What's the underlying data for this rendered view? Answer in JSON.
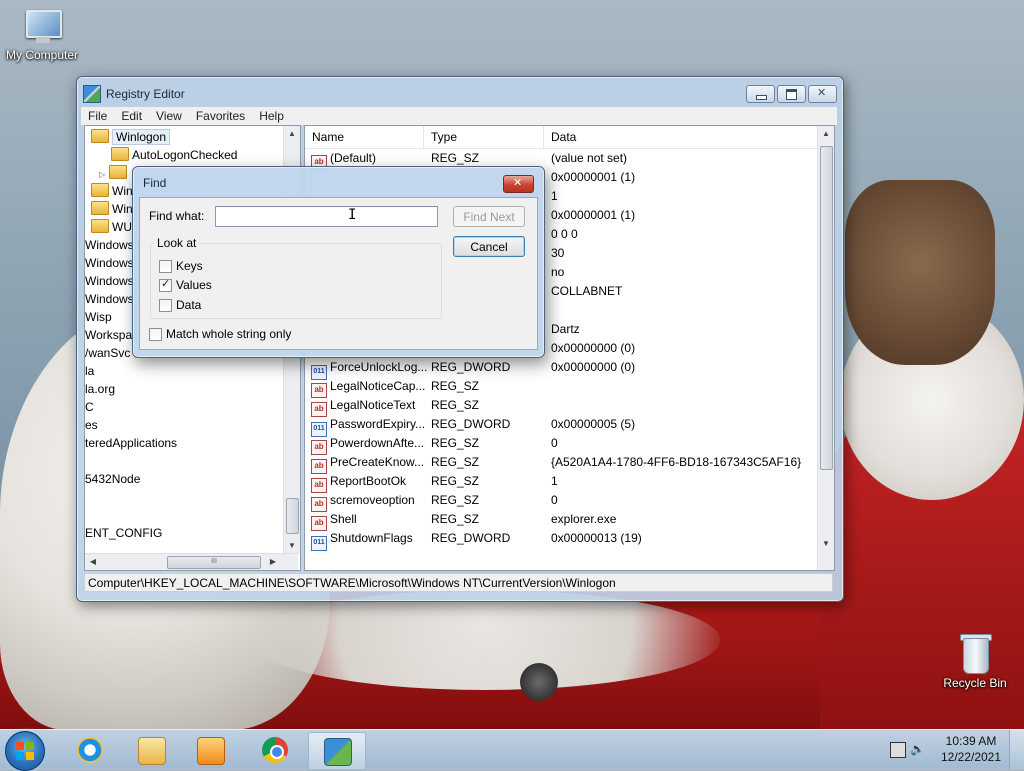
{
  "desktop": {
    "icons": [
      {
        "label": "My Computer",
        "icon": "computer-icon"
      },
      {
        "label": "Recycle Bin",
        "icon": "recycle-bin-icon"
      }
    ]
  },
  "window": {
    "title": "Registry Editor",
    "menu": [
      "File",
      "Edit",
      "View",
      "Favorites",
      "Help"
    ],
    "tree": [
      {
        "label": "Winlogon",
        "selected": true
      },
      {
        "label": "AutoLogonChecked"
      },
      {
        "label": "Win"
      },
      {
        "label": "Win"
      },
      {
        "label": "WU"
      },
      {
        "label": "Windows P"
      },
      {
        "label": "Windows P"
      },
      {
        "label": "Windows S"
      },
      {
        "label": "Windows S"
      },
      {
        "label": "Wisp"
      },
      {
        "label": "Workspace"
      },
      {
        "label": "/wanSvc"
      },
      {
        "label": "la"
      },
      {
        "label": "la.org"
      },
      {
        "label": "C"
      },
      {
        "label": "es"
      },
      {
        "label": "teredApplications"
      },
      {
        "label": "5432Node"
      },
      {
        "label": "ENT_CONFIG"
      }
    ],
    "columns": [
      "Name",
      "Type",
      "Data"
    ],
    "rows": [
      {
        "name": "(Default)",
        "type": "REG_SZ",
        "data": "(value not set)",
        "icon": "string-value-icon"
      },
      {
        "name": "",
        "type": "",
        "data": "0x00000001 (1)",
        "icon": ""
      },
      {
        "name": "",
        "type": "",
        "data": "1",
        "icon": ""
      },
      {
        "name": "",
        "type": "",
        "data": "0x00000001 (1)",
        "icon": ""
      },
      {
        "name": "",
        "type": "",
        "data": "0 0 0",
        "icon": ""
      },
      {
        "name": "",
        "type": "",
        "data": "30",
        "icon": ""
      },
      {
        "name": "",
        "type": "",
        "data": "no",
        "icon": ""
      },
      {
        "name": "",
        "type": "",
        "data": "COLLABNET",
        "icon": ""
      },
      {
        "name": "",
        "type": "",
        "data": "",
        "icon": ""
      },
      {
        "name": "",
        "type": "",
        "data": "Dartz",
        "icon": ""
      },
      {
        "name": "",
        "type": "",
        "data": "0x00000000 (0)",
        "icon": ""
      },
      {
        "name": "ForceUnlockLog...",
        "type": "REG_DWORD",
        "data": "0x00000000 (0)",
        "icon": "binary-value-icon"
      },
      {
        "name": "LegalNoticeCap...",
        "type": "REG_SZ",
        "data": "",
        "icon": "string-value-icon"
      },
      {
        "name": "LegalNoticeText",
        "type": "REG_SZ",
        "data": "",
        "icon": "string-value-icon"
      },
      {
        "name": "PasswordExpiry...",
        "type": "REG_DWORD",
        "data": "0x00000005 (5)",
        "icon": "binary-value-icon"
      },
      {
        "name": "PowerdownAfte...",
        "type": "REG_SZ",
        "data": "0",
        "icon": "string-value-icon"
      },
      {
        "name": "PreCreateKnow...",
        "type": "REG_SZ",
        "data": "{A520A1A4-1780-4FF6-BD18-167343C5AF16}",
        "icon": "string-value-icon"
      },
      {
        "name": "ReportBootOk",
        "type": "REG_SZ",
        "data": "1",
        "icon": "string-value-icon"
      },
      {
        "name": "scremoveoption",
        "type": "REG_SZ",
        "data": "0",
        "icon": "string-value-icon"
      },
      {
        "name": "Shell",
        "type": "REG_SZ",
        "data": "explorer.exe",
        "icon": "string-value-icon"
      },
      {
        "name": "ShutdownFlags",
        "type": "REG_DWORD",
        "data": "0x00000013 (19)",
        "icon": "binary-value-icon"
      }
    ],
    "status": "Computer\\HKEY_LOCAL_MACHINE\\SOFTWARE\\Microsoft\\Windows NT\\CurrentVersion\\Winlogon"
  },
  "find_dialog": {
    "title": "Find",
    "find_what_label": "Find what:",
    "find_what_value": "",
    "find_next_label": "Find Next",
    "cancel_label": "Cancel",
    "look_at_label": "Look at",
    "options": [
      {
        "label": "Keys",
        "checked": false
      },
      {
        "label": "Values",
        "checked": true
      },
      {
        "label": "Data",
        "checked": false
      }
    ],
    "match_whole_label": "Match whole string only",
    "match_whole_checked": false
  },
  "taskbar": {
    "apps": [
      "internet-explorer-icon",
      "windows-explorer-icon",
      "media-player-icon",
      "chrome-icon",
      "regedit-icon"
    ],
    "active_app": "regedit-icon",
    "time": "10:39 AM",
    "date": "12/22/2021"
  }
}
